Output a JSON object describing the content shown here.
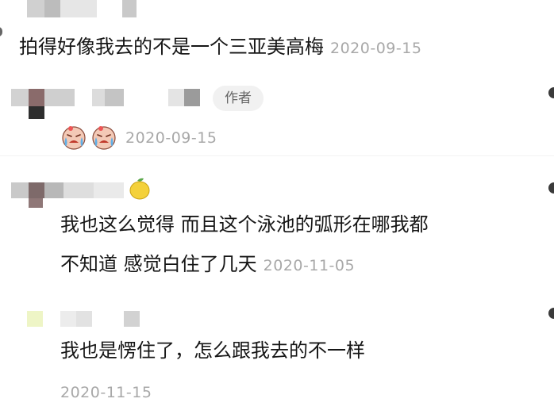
{
  "comments": [
    {
      "text": "拍得好像我去的不是一个三亚美高梅",
      "date": "2020-09-15"
    },
    {
      "badge": "作者",
      "emoji": [
        "crying-face-icon",
        "crying-face-icon"
      ],
      "date": "2020-09-15"
    },
    {
      "line1": "我也这么觉得 而且这个泳池的弧形在哪我都",
      "line2": "不知道 感觉白住了几天",
      "date": "2020-11-05"
    },
    {
      "text": "我也是愣住了，怎么跟我去的不一样",
      "date": "2020-11-15"
    }
  ],
  "colors": {
    "date": "#a8a8a8",
    "badge_bg": "#f1f1f1",
    "badge_text": "#666666"
  }
}
